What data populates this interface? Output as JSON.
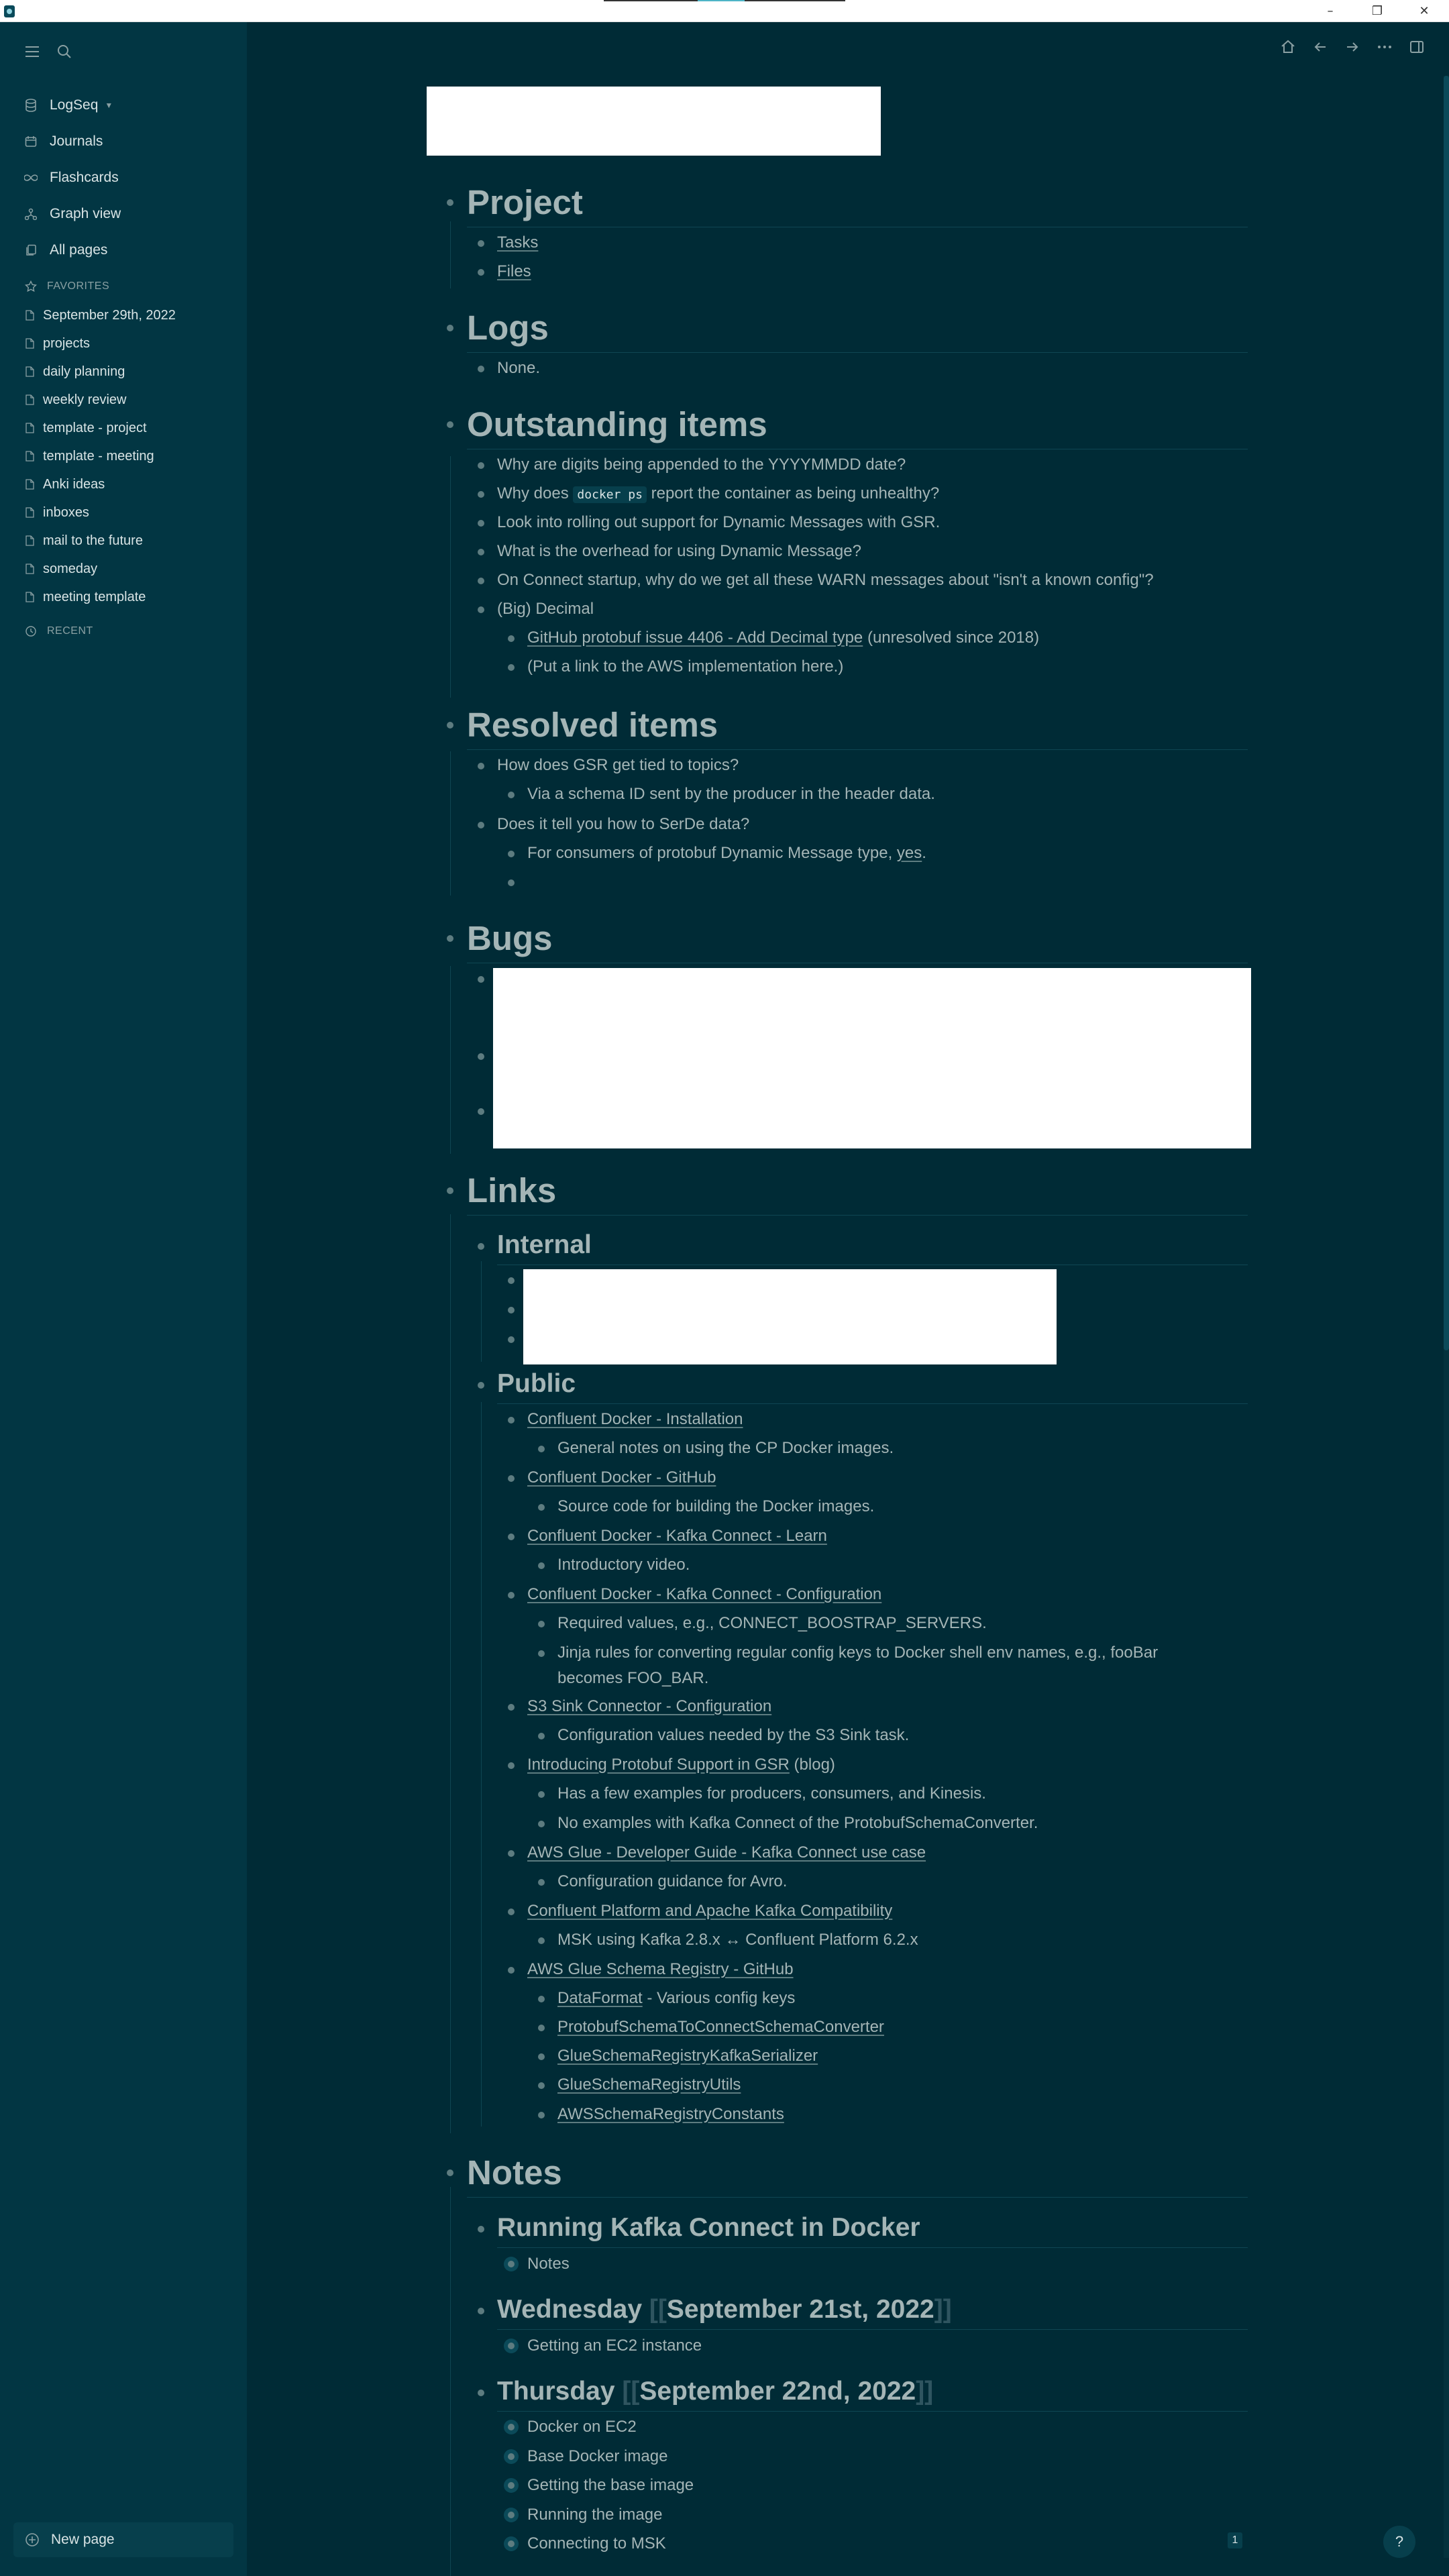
{
  "sidebar": {
    "graph_name": "LogSeq",
    "nav": [
      {
        "label": "Journals",
        "icon": "calendar-icon"
      },
      {
        "label": "Flashcards",
        "icon": "infinity-icon"
      },
      {
        "label": "Graph view",
        "icon": "graph-icon"
      },
      {
        "label": "All pages",
        "icon": "pages-icon"
      }
    ],
    "favorites_label": "FAVORITES",
    "favorites": [
      "September 29th, 2022",
      "projects",
      "daily planning",
      "weekly review",
      "template - project",
      "template - meeting",
      "Anki ideas",
      "inboxes",
      "mail to the future",
      "someday",
      "meeting template"
    ],
    "recent_label": "RECENT",
    "new_page_label": "New page"
  },
  "content": {
    "project": {
      "heading": "Project",
      "items": [
        "Tasks",
        "Files"
      ]
    },
    "logs": {
      "heading": "Logs",
      "items": [
        "None."
      ]
    },
    "outstanding": {
      "heading": "Outstanding items",
      "i1": "Why are digits being appended to the YYYYMMDD date?",
      "i2_pre": "Why does ",
      "i2_code": "docker ps",
      "i2_post": " report the container as being unhealthy?",
      "i3": "Look into rolling out support for Dynamic Messages with GSR.",
      "i4": "What is the overhead for using Dynamic Message?",
      "i5": "On Connect startup, why do we get all these WARN messages about \"isn't a known config\"?",
      "i6": "(Big) Decimal",
      "i6a_link": "GitHub protobuf issue 4406 - Add Decimal type",
      "i6a_post": " (unresolved since 2018)",
      "i6b": "(Put a link to the AWS implementation here.)"
    },
    "resolved": {
      "heading": "Resolved items",
      "r1": "How does GSR get tied to topics?",
      "r1a": "Via a schema ID sent by the producer in the header data.",
      "r2": "Does it tell you how to SerDe data?",
      "r2a_pre": "For consumers of protobuf Dynamic Message type, ",
      "r2a_link": "yes",
      "r2a_post": "."
    },
    "bugs": {
      "heading": "Bugs"
    },
    "links": {
      "heading": "Links",
      "internal": "Internal",
      "public": "Public",
      "p1": "Confluent Docker - Installation",
      "p1a": "General notes on using the CP Docker images.",
      "p2": "Confluent Docker - GitHub",
      "p2a": "Source code for building the Docker images.",
      "p3": "Confluent Docker - Kafka Connect - Learn",
      "p3a": "Introductory video.",
      "p4": "Confluent Docker - Kafka Connect - Configuration",
      "p4a": "Required values, e.g., CONNECT_BOOSTRAP_SERVERS.",
      "p4b_l1": "Jinja rules for converting regular config keys to Docker shell env names, e.g., fooBar",
      "p4b_l2": "becomes FOO_BAR.",
      "p5": "S3 Sink Connector - Configuration",
      "p5a": "Configuration values needed by the S3 Sink task.",
      "p6": "Introducing Protobuf Support in GSR",
      "p6_post": " (blog)",
      "p6a": "Has a few examples for producers, consumers, and Kinesis.",
      "p6b": "No examples with Kafka Connect of the ProtobufSchemaConverter.",
      "p7": "AWS Glue - Developer Guide - Kafka Connect use case",
      "p7a": "Configuration guidance for Avro.",
      "p8": "Confluent Platform and Apache Kafka Compatibility",
      "p8a": "MSK using Kafka 2.8.x ↔ Confluent Platform 6.2.x",
      "p9": "AWS Glue Schema Registry - GitHub",
      "p9a_link": "DataFormat",
      "p9a_post": " - Various config keys",
      "p9b": "ProtobufSchemaToConnectSchemaConverter",
      "p9c": "GlueSchemaRegistryKafkaSerializer",
      "p9d": "GlueSchemaRegistryUtils",
      "p9e": "AWSSchemaRegistryConstants"
    },
    "notes": {
      "heading": "Notes",
      "n1": "Running Kafka Connect in Docker",
      "n1a": "Notes",
      "n2_pre": "Wednesday ",
      "n2_date": "September 21st, 2022",
      "n2a": "Getting an EC2 instance",
      "n3_pre": "Thursday ",
      "n3_date": "September 22nd, 2022",
      "n3a": "Docker on EC2",
      "n3b": "Base Docker image",
      "n3c": "Getting the base image",
      "n3d": "Running the image",
      "n3e": "Connecting to MSK"
    }
  },
  "footer": {
    "page_count": "1",
    "help": "?"
  }
}
